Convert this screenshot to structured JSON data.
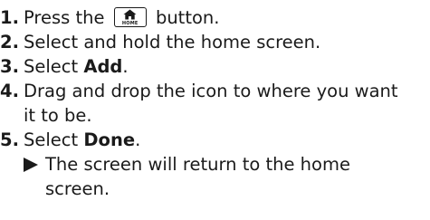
{
  "steps": [
    {
      "num": "1.",
      "before": "Press the",
      "icon": "home-button-icon",
      "icon_label": "HOME",
      "after": "button."
    },
    {
      "num": "2.",
      "text": "Select and hold the home screen."
    },
    {
      "num": "3.",
      "before": "Select ",
      "bold": "Add",
      "after": "."
    },
    {
      "num": "4.",
      "line1": "Drag and drop the icon to where you want",
      "line2": "it to be."
    },
    {
      "num": "5.",
      "before": "Select ",
      "bold": "Done",
      "after": "."
    }
  ],
  "result": {
    "icon": "triangle-right-icon",
    "line1": "The screen will return to the home",
    "line2": "screen."
  }
}
